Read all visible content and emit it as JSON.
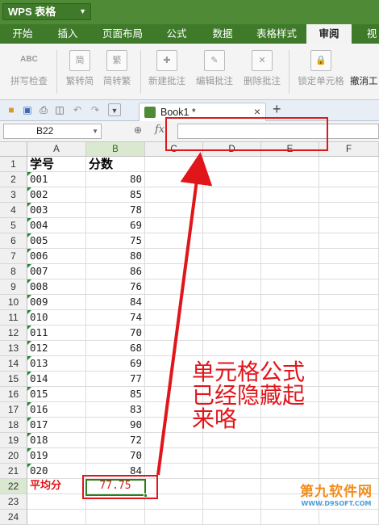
{
  "app": {
    "title": "WPS 表格"
  },
  "menu": [
    {
      "label": "开始",
      "active": false
    },
    {
      "label": "插入",
      "active": false
    },
    {
      "label": "页面布局",
      "active": false
    },
    {
      "label": "公式",
      "active": false
    },
    {
      "label": "数据",
      "active": false
    },
    {
      "label": "表格样式",
      "active": false
    },
    {
      "label": "审阅",
      "active": true
    },
    {
      "label": "视",
      "active": false
    }
  ],
  "ribbon": {
    "spellcheck": "拼写检查",
    "trad_to_simp": "繁转简",
    "simp_to_trad": "简转繁",
    "new_comment": "新建批注",
    "edit_comment": "编辑批注",
    "delete_comment": "删除批注",
    "lock_cell": "锁定单元格",
    "undo_partial": "撤消工",
    "icon_abc": "ABC",
    "icon_simp": "简",
    "icon_trad": "繁"
  },
  "tab": {
    "name": "Book1 *"
  },
  "formula": {
    "name_box": "B22",
    "value": ""
  },
  "columns": [
    "A",
    "B",
    "C",
    "D",
    "E",
    "F"
  ],
  "rows": [
    {
      "n": "1",
      "a": "学号",
      "b": "分数"
    },
    {
      "n": "2",
      "a": "001",
      "b": "80"
    },
    {
      "n": "3",
      "a": "002",
      "b": "85"
    },
    {
      "n": "4",
      "a": "003",
      "b": "78"
    },
    {
      "n": "5",
      "a": "004",
      "b": "69"
    },
    {
      "n": "6",
      "a": "005",
      "b": "75"
    },
    {
      "n": "7",
      "a": "006",
      "b": "80"
    },
    {
      "n": "8",
      "a": "007",
      "b": "86"
    },
    {
      "n": "9",
      "a": "008",
      "b": "76"
    },
    {
      "n": "10",
      "a": "009",
      "b": "84"
    },
    {
      "n": "11",
      "a": "010",
      "b": "74"
    },
    {
      "n": "12",
      "a": "011",
      "b": "70"
    },
    {
      "n": "13",
      "a": "012",
      "b": "68"
    },
    {
      "n": "14",
      "a": "013",
      "b": "69"
    },
    {
      "n": "15",
      "a": "014",
      "b": "77"
    },
    {
      "n": "16",
      "a": "015",
      "b": "85"
    },
    {
      "n": "17",
      "a": "016",
      "b": "83"
    },
    {
      "n": "18",
      "a": "017",
      "b": "90"
    },
    {
      "n": "19",
      "a": "018",
      "b": "72"
    },
    {
      "n": "20",
      "a": "019",
      "b": "70"
    },
    {
      "n": "21",
      "a": "020",
      "b": "84"
    },
    {
      "n": "22",
      "a": "平均分",
      "b": "77.75"
    },
    {
      "n": "23",
      "a": "",
      "b": ""
    },
    {
      "n": "24",
      "a": "",
      "b": ""
    }
  ],
  "annotation": {
    "text": "单元格公式\n已经隐藏起\n来咯",
    "color": "#e0161b"
  },
  "watermark": {
    "main": "第九软件网",
    "sub": "WWW.D9SOFT.COM"
  },
  "colors": {
    "accent_green": "#4f8a36",
    "highlight_red": "#e0161b"
  }
}
